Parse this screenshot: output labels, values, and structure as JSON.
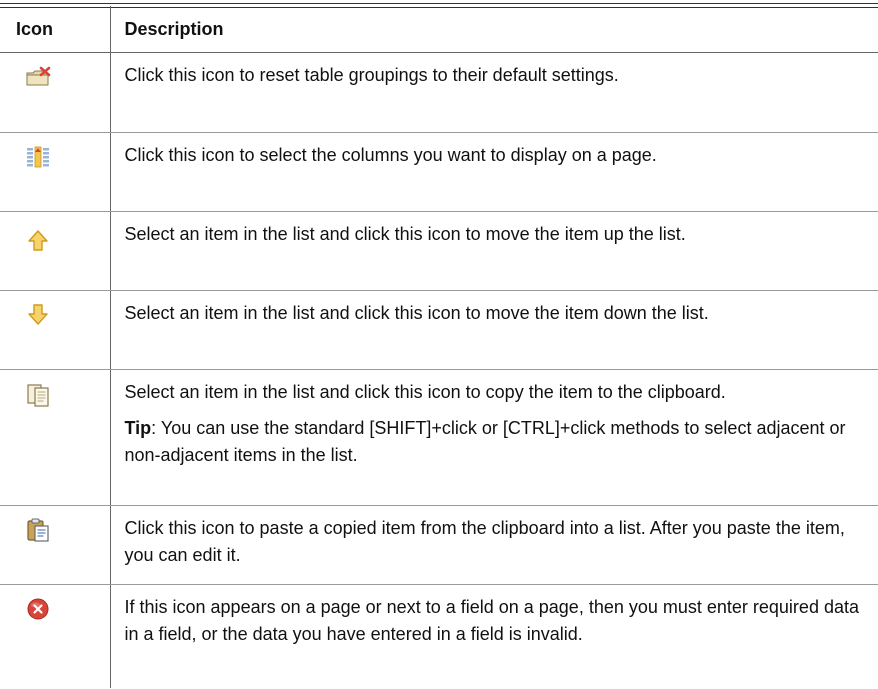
{
  "header": {
    "icon": "Icon",
    "description": "Description"
  },
  "rows": [
    {
      "icon": "reset-table-groupings-icon",
      "description": "Click this icon to reset table groupings to their default settings."
    },
    {
      "icon": "select-columns-icon",
      "description": "Click this icon to select the columns you want to display on a page."
    },
    {
      "icon": "move-up-arrow-icon",
      "description": "Select an item in the list and click this icon to move the item up the list."
    },
    {
      "icon": "move-down-arrow-icon",
      "description": "Select an item in the list and click this icon to move the item down the list."
    },
    {
      "icon": "copy-icon",
      "description": "Select an item in the list and click this icon to copy the item to the clipboard.",
      "tip_label": "Tip",
      "tip_text": ": You can use the standard [SHIFT]+click or [CTRL]+click methods to select adjacent or non-adjacent items in the list."
    },
    {
      "icon": "paste-icon",
      "description": "Click this icon to paste a copied item from the clipboard into a list. After you paste the item, you can edit it."
    },
    {
      "icon": "error-icon",
      "description": "If this icon appears on a page or next to a field on a page, then you must enter required data in a field, or the data you have entered in a field is invalid."
    }
  ],
  "colors": {
    "arrow_fill": "#f7d46b",
    "arrow_stroke": "#d19a1b",
    "error_red": "#d8443a",
    "rule": "#333333"
  }
}
